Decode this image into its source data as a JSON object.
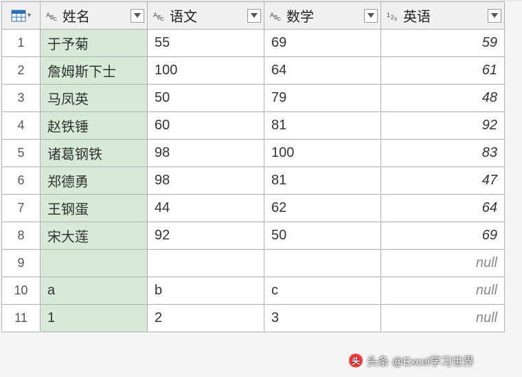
{
  "columns": {
    "name": {
      "label": "姓名",
      "type": "text"
    },
    "yuwen": {
      "label": "语文",
      "type": "text"
    },
    "shuxue": {
      "label": "数学",
      "type": "text"
    },
    "yingyu": {
      "label": "英语",
      "type": "number"
    }
  },
  "rows": [
    {
      "idx": "1",
      "name": "于予菊",
      "yuwen": "55",
      "shuxue": "69",
      "yingyu": "59"
    },
    {
      "idx": "2",
      "name": "詹姆斯下士",
      "yuwen": "100",
      "shuxue": "64",
      "yingyu": "61"
    },
    {
      "idx": "3",
      "name": "马凤英",
      "yuwen": "50",
      "shuxue": "79",
      "yingyu": "48"
    },
    {
      "idx": "4",
      "name": "赵铁锤",
      "yuwen": "60",
      "shuxue": "81",
      "yingyu": "92"
    },
    {
      "idx": "5",
      "name": "诸葛钢铁",
      "yuwen": "98",
      "shuxue": "100",
      "yingyu": "83"
    },
    {
      "idx": "6",
      "name": "郑德勇",
      "yuwen": "98",
      "shuxue": "81",
      "yingyu": "47"
    },
    {
      "idx": "7",
      "name": "王钢蛋",
      "yuwen": "44",
      "shuxue": "62",
      "yingyu": "64"
    },
    {
      "idx": "8",
      "name": "宋大莲",
      "yuwen": "92",
      "shuxue": "50",
      "yingyu": "69"
    },
    {
      "idx": "9",
      "name": "",
      "yuwen": "",
      "shuxue": "",
      "yingyu": "null"
    },
    {
      "idx": "10",
      "name": "a",
      "yuwen": "b",
      "shuxue": "c",
      "yingyu": "null"
    },
    {
      "idx": "11",
      "name": "1",
      "yuwen": "2",
      "shuxue": "3",
      "yingyu": "null"
    }
  ],
  "watermark": "头条 @Excel学习世界"
}
